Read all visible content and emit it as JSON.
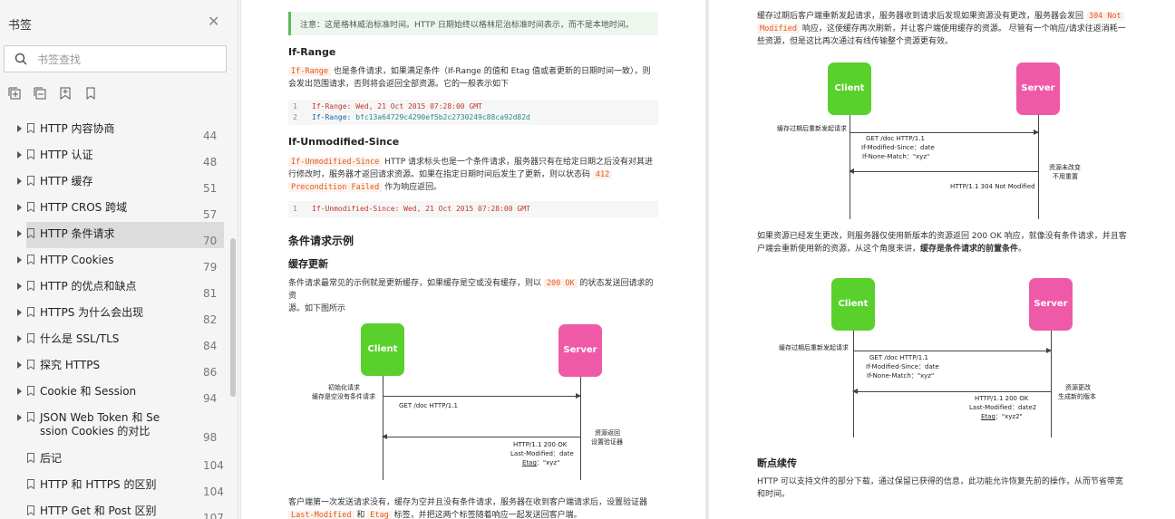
{
  "sidebar": {
    "title": "书签",
    "search_placeholder": "书签查找",
    "tools": [
      "expand-all-icon",
      "collapse-all-icon",
      "add-bookmark-icon",
      "bookmark-icon"
    ],
    "items": [
      {
        "label": "HTTP 内容协商",
        "page": "44",
        "arrow": true
      },
      {
        "label": "HTTP 认证",
        "page": "48",
        "arrow": true
      },
      {
        "label": "HTTP 缓存",
        "page": "51",
        "arrow": true
      },
      {
        "label": "HTTP CROS 跨域",
        "page": "57",
        "arrow": true
      },
      {
        "label": "HTTP 条件请求",
        "page": "70",
        "arrow": true,
        "active": true
      },
      {
        "label": "HTTP Cookies",
        "page": "79",
        "arrow": true
      },
      {
        "label": "HTTP 的优点和缺点",
        "page": "81",
        "arrow": true
      },
      {
        "label": "HTTPS 为什么会出现",
        "page": "82",
        "arrow": true
      },
      {
        "label": "什么是 SSL/TLS",
        "page": "84",
        "arrow": true
      },
      {
        "label": "探究 HTTPS",
        "page": "86",
        "arrow": true
      },
      {
        "label": "Cookie 和 Session",
        "page": "94",
        "arrow": true
      },
      {
        "label": "JSON Web Token 和 Session Cookies 的对比",
        "label_line1": "JSON Web Token 和 Se",
        "label_line2": "ssion Cookies 的对比",
        "page": "98",
        "arrow": true
      },
      {
        "label": "后记",
        "page": "104",
        "arrow": false
      },
      {
        "label": "HTTP 和 HTTPS 的区别",
        "page": "104",
        "arrow": false
      },
      {
        "label": "HTTP Get 和 Post 区别",
        "page": "107",
        "arrow": false
      }
    ]
  },
  "page1": {
    "note": "注意：这是格林威治标准时间。HTTP 日期始终以格林尼治标准时间表示，而不是本地时间。",
    "if_range": {
      "heading": "If-Range",
      "code": "If-Range",
      "text1": "也是条件请求，如果满足条件（If-Range 的值和 Etag 值或者更新的日期时间一致），则",
      "text2": "会发出范围请求，否则将会返回全部资源。它的一般表示如下",
      "lines": [
        {
          "n": "1",
          "key": "If-Range:",
          "val": "Wed, 21 Oct 2015 07:28:00 GMT"
        },
        {
          "n": "2",
          "key": "If-Range:",
          "val": "bfc13a64729c4290ef5b2c2730249c88ca92d82d"
        }
      ]
    },
    "if_unmodified": {
      "heading": "If-Unmodified-Since",
      "code": "If-Unmodified-Since",
      "text1": "HTTP 请求标头也是一个条件请求，服务器只有在给定日期之后没有对其进",
      "text2": "行修改时，服务器才返回请求资源。如果在指定日期时间后发生了更新，则以状态码",
      "code2": "412",
      "code3": "Precondition Failed",
      "text3": "作为响应返回。",
      "line": {
        "n": "1",
        "text": "If-Unmodified-Since: Wed, 21 Oct 2015 07:28:00 GMT"
      }
    },
    "example_heading": "条件请求示例",
    "cache_heading": "缓存更新",
    "cache_text1a": "条件请求最常见的示例就是更新缓存，如果缓存是空或没有缓存，则以",
    "cache_code": "200 OK",
    "cache_text1b": "的状态发送回请求的资",
    "cache_text2": "源。如下图所示",
    "diagram": {
      "client": "Client",
      "server": "Server",
      "left_note1": "初始化请求",
      "left_note2": "缓存是空没有条件请求",
      "request": "GET /doc  HTTP/1.1",
      "right_note1": "资源返回",
      "right_note2": "设置验证器",
      "resp1": "HTTP/1.1  200  OK",
      "resp2": "Last-Modified：date",
      "resp3_key": "Etag",
      "resp3_val": "：\"xyz\""
    },
    "bottom_text1": "客户端第一次发送请求没有，缓存为空并且没有条件请求，服务器在收到客户端请求后，设置验证器",
    "bottom_code1": "Last-Modified",
    "bottom_and": "和",
    "bottom_code2": "Etag",
    "bottom_text2": "标签，并把这两个标签随着响应一起发送回客户端。"
  },
  "page2": {
    "top_text1a": "缓存过期后客户端重新发起请求，服务器收到请求后发现如果资源没有更改，服务器会发回",
    "top_code1": "304 Not",
    "top_code2": "Modified",
    "top_text2": "响应，这使缓存再次刷新，并让客户端使用缓存的资源。 尽管有一个响应/请求往返消耗一",
    "top_text3": "些资源，但是这比再次通过有线传输整个资源更有效。",
    "diagram1": {
      "client": "Client",
      "server": "Server",
      "left_note": "缓存过期后重新发起请求",
      "req1": "GET /doc  HTTP/1.1",
      "req2": "If-Modified-Since：date",
      "req3": "If-None-Match：\"xyz\"",
      "right_note1": "资源未改变",
      "right_note2": "不用重置",
      "resp": "HTTP/1.1  304  Not Modified"
    },
    "mid_text1": "如果资源已经发生更改，则服务器仅使用新版本的资源返回 200 OK 响应，就像没有条件请求，并且客",
    "mid_text2a": "户端会重新使用新的资源，从这个角度来讲，",
    "mid_text2b": "缓存是条件请求的前置条件",
    "mid_text2c": "。",
    "diagram2": {
      "client": "Client",
      "server": "Server",
      "left_note": "缓存过期后重新发起请求",
      "req1": "GET /doc  HTTP/1.1",
      "req2": "If-Modified-Since：date",
      "req3": "If-None-Match：\"xyz\"",
      "right_note1": "资源更改",
      "right_note2": "生成新的版本",
      "resp1": "HTTP/1.1  200  OK",
      "resp2": "Last-Modified：date2",
      "resp3_key": "Etag",
      "resp3_val": "：\"xyz2\""
    },
    "resume_heading": "断点续传",
    "resume_text1": "HTTP 可以支持文件的部分下载，通过保留已获得的信息，此功能允许恢复先前的操作，从而节省带宽",
    "resume_text2": "和时间。"
  },
  "colors": {
    "client": "#5ad02d",
    "server": "#ef5aa8",
    "code": "#e05a20",
    "note_bar": "#5cb85c"
  }
}
